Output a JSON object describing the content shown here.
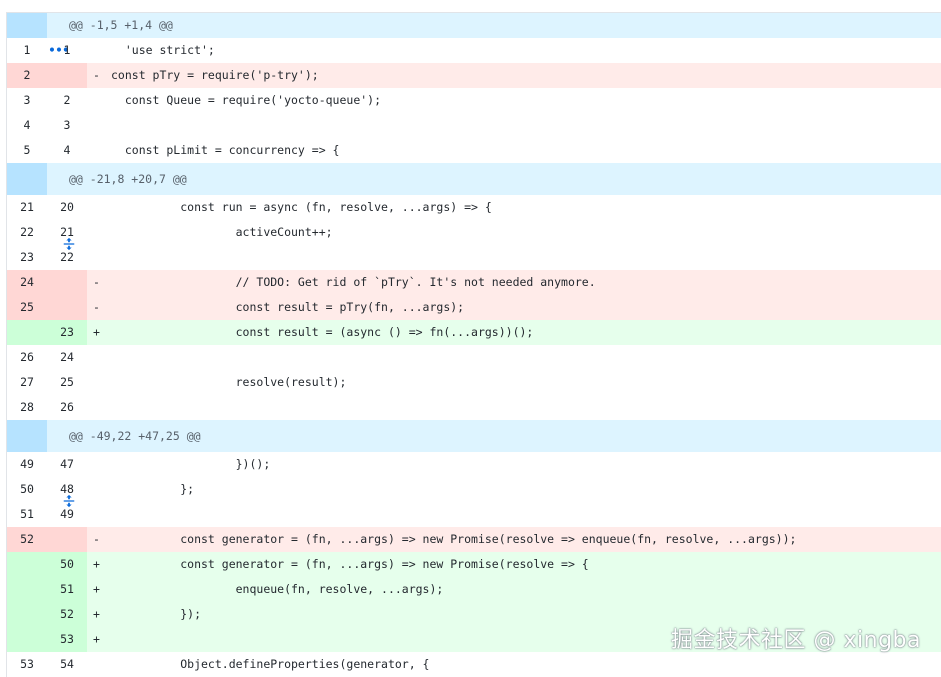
{
  "hunks": [
    {
      "header": "@@ -1,5 +1,4 @@",
      "expander_icon": "dots-icon"
    },
    {
      "header": "@@ -21,8 +20,7 @@",
      "expander_icon": "unfold-icon"
    },
    {
      "header": "@@ -49,22 +47,25 @@",
      "expander_icon": "unfold-icon"
    }
  ],
  "lines": [
    {
      "old": "1",
      "new": "1",
      "type": "ctx",
      "marker": "",
      "code": "  'use strict';"
    },
    {
      "old": "2",
      "new": "",
      "type": "del",
      "marker": "-",
      "code": "const pTry = require('p-try');"
    },
    {
      "old": "3",
      "new": "2",
      "type": "ctx",
      "marker": "",
      "code": "  const Queue = require('yocto-queue');"
    },
    {
      "old": "4",
      "new": "3",
      "type": "ctx",
      "marker": "",
      "code": ""
    },
    {
      "old": "5",
      "new": "4",
      "type": "ctx",
      "marker": "",
      "code": "  const pLimit = concurrency => {"
    },
    {
      "old": "21",
      "new": "20",
      "type": "ctx",
      "marker": "",
      "code": "          const run = async (fn, resolve, ...args) => {"
    },
    {
      "old": "22",
      "new": "21",
      "type": "ctx",
      "marker": "",
      "code": "                  activeCount++;"
    },
    {
      "old": "23",
      "new": "22",
      "type": "ctx",
      "marker": "",
      "code": ""
    },
    {
      "old": "24",
      "new": "",
      "type": "del",
      "marker": "-",
      "code": "                  // TODO: Get rid of `pTry`. It's not needed anymore."
    },
    {
      "old": "25",
      "new": "",
      "type": "del",
      "marker": "-",
      "code": "                  const result = pTry(fn, ...args);"
    },
    {
      "old": "",
      "new": "23",
      "type": "add",
      "marker": "+",
      "code": "                  const result = (async () => fn(...args))();"
    },
    {
      "old": "26",
      "new": "24",
      "type": "ctx",
      "marker": "",
      "code": ""
    },
    {
      "old": "27",
      "new": "25",
      "type": "ctx",
      "marker": "",
      "code": "                  resolve(result);"
    },
    {
      "old": "28",
      "new": "26",
      "type": "ctx",
      "marker": "",
      "code": ""
    },
    {
      "old": "49",
      "new": "47",
      "type": "ctx",
      "marker": "",
      "code": "                  })();"
    },
    {
      "old": "50",
      "new": "48",
      "type": "ctx",
      "marker": "",
      "code": "          };"
    },
    {
      "old": "51",
      "new": "49",
      "type": "ctx",
      "marker": "",
      "code": ""
    },
    {
      "old": "52",
      "new": "",
      "type": "del",
      "marker": "-",
      "code": "          const generator = (fn, ...args) => new Promise(resolve => enqueue(fn, resolve, ...args));"
    },
    {
      "old": "",
      "new": "50",
      "type": "add",
      "marker": "+",
      "code": "          const generator = (fn, ...args) => new Promise(resolve => {"
    },
    {
      "old": "",
      "new": "51",
      "type": "add",
      "marker": "+",
      "code": "                  enqueue(fn, resolve, ...args);"
    },
    {
      "old": "",
      "new": "52",
      "type": "add",
      "marker": "+",
      "code": "          });"
    },
    {
      "old": "",
      "new": "53",
      "type": "add",
      "marker": "+",
      "code": ""
    },
    {
      "old": "53",
      "new": "54",
      "type": "ctx",
      "marker": "",
      "code": "          Object.defineProperties(generator, {"
    }
  ],
  "watermark": "掘金技术社区 @ xingba",
  "colors": {
    "hunk_bg": "#ddf4ff",
    "expander_bg": "#b6e3ff",
    "del_bg": "#ffebe9",
    "del_num_bg": "#ffd7d5",
    "add_bg": "#e6ffec",
    "add_num_bg": "#ccffd8"
  }
}
